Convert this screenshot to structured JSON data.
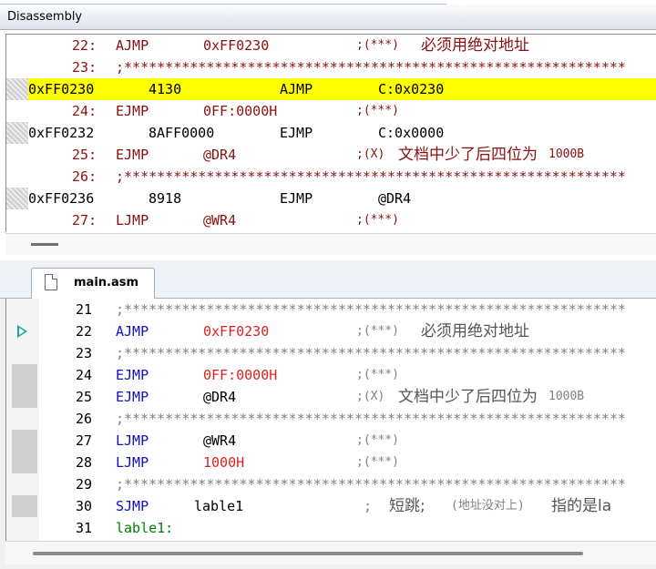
{
  "disassembly": {
    "title": "Disassembly",
    "lines": [
      {
        "type": "src",
        "num": "22:",
        "mnem": "AJMP",
        "op": "0xFF0230",
        "cmt": ";(***)",
        "cn": "必须用绝对地址"
      },
      {
        "type": "sep",
        "num": "23:",
        "text": ";*************************************************************"
      },
      {
        "type": "addr",
        "addr": "0xFF0230",
        "code": "4130",
        "mnem": "AJMP",
        "op": "C:0x0230",
        "highlight": true
      },
      {
        "type": "src",
        "num": "24:",
        "mnem": "EJMP",
        "op": "0FF:0000H",
        "cmt": ";(***)",
        "cn": ""
      },
      {
        "type": "addr",
        "addr": "0xFF0232",
        "code": "8AFF0000",
        "mnem": "EJMP",
        "op": "C:0x0000",
        "highlight": false
      },
      {
        "type": "src",
        "num": "25:",
        "mnem": "EJMP",
        "op": "@DR4",
        "cmt": ";(X)",
        "cn": "文档中少了后四位为",
        "tail": "1000B"
      },
      {
        "type": "sep",
        "num": "26:",
        "text": ";*************************************************************"
      },
      {
        "type": "addr",
        "addr": "0xFF0236",
        "code": "8918",
        "mnem": "EJMP",
        "op": "@DR4",
        "highlight": false
      },
      {
        "type": "src",
        "num": "27:",
        "mnem": "LJMP",
        "op": "@WR4",
        "cmt": ";(***)",
        "cn": ""
      }
    ]
  },
  "editor": {
    "tab_label": "main.asm",
    "current_line": "22",
    "lines": [
      {
        "num": "21",
        "kind": "sep",
        "text": ";*************************************************************"
      },
      {
        "num": "22",
        "kind": "code",
        "mnem": "AJMP",
        "op": "0xFF0230",
        "op_color": "red",
        "cmt": ";(***)",
        "cn": "必须用绝对地址",
        "cov": false
      },
      {
        "num": "23",
        "kind": "sep",
        "text": ";*************************************************************"
      },
      {
        "num": "24",
        "kind": "code",
        "mnem": "EJMP",
        "op": "0FF:0000H",
        "op_color": "red",
        "cmt": ";(***)",
        "cn": "",
        "cov": true
      },
      {
        "num": "25",
        "kind": "code",
        "mnem": "EJMP",
        "op": "@DR4",
        "op_color": "black",
        "cmt": ";(X)",
        "cn": "文档中少了后四位为",
        "tail": "1000B",
        "cov": true
      },
      {
        "num": "26",
        "kind": "sep",
        "text": ";*************************************************************"
      },
      {
        "num": "27",
        "kind": "code",
        "mnem": "LJMP",
        "op": "@WR4",
        "op_color": "black",
        "cmt": ";(***)",
        "cn": "",
        "cov": true
      },
      {
        "num": "28",
        "kind": "code",
        "mnem": "LJMP",
        "op": "1000H",
        "op_color": "red",
        "cmt": ";(***)",
        "cn": "",
        "cov": true
      },
      {
        "num": "29",
        "kind": "sep",
        "text": ";*************************************************************"
      },
      {
        "num": "30",
        "kind": "code",
        "mnem": "SJMP",
        "op": "lable1",
        "op_color": "black",
        "cmt": ";",
        "cn": "短跳;",
        "cmt2": "(地址没对上)",
        "cn2": "指的是la",
        "cov": true
      },
      {
        "num": "31",
        "kind": "label",
        "text": "lable1:",
        "cov": false
      }
    ]
  }
}
